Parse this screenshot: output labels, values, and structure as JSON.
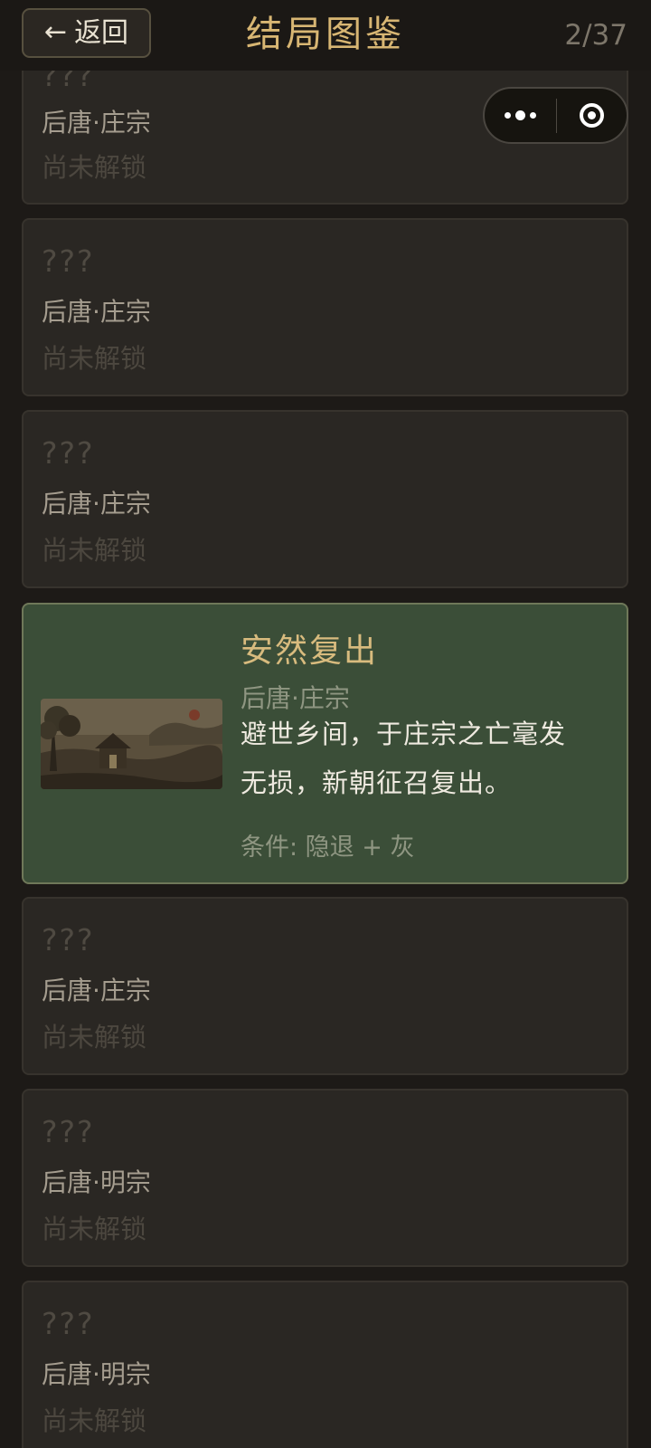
{
  "header": {
    "back_arrow": "←",
    "back_label": "返回",
    "title": "结局图鉴",
    "page_indicator": "2/37"
  },
  "capsule": {
    "more_icon": "more-dots",
    "close_icon": "target-ring"
  },
  "cards": [
    {
      "title": "???",
      "era": "后唐·庄宗",
      "status": "尚未解锁"
    },
    {
      "title": "???",
      "era": "后唐·庄宗",
      "status": "尚未解锁"
    },
    {
      "title": "???",
      "era": "后唐·庄宗",
      "status": "尚未解锁"
    },
    {
      "title": "安然复出",
      "era": "后唐·庄宗",
      "description_line1": "避世乡间，于庄宗之亡毫发",
      "description_line2": "无损，新朝征召复出。",
      "condition": "条件: 隐退 + 灰"
    },
    {
      "title": "???",
      "era": "后唐·庄宗",
      "status": "尚未解锁"
    },
    {
      "title": "???",
      "era": "后唐·明宗",
      "status": "尚未解锁"
    },
    {
      "title": "???",
      "era": "后唐·明宗",
      "status": "尚未解锁"
    }
  ],
  "colors": {
    "background": "#1d1a17",
    "card": "#2a2723",
    "unlocked_card": "#3b4e38",
    "accent_gold": "#d8b673"
  }
}
